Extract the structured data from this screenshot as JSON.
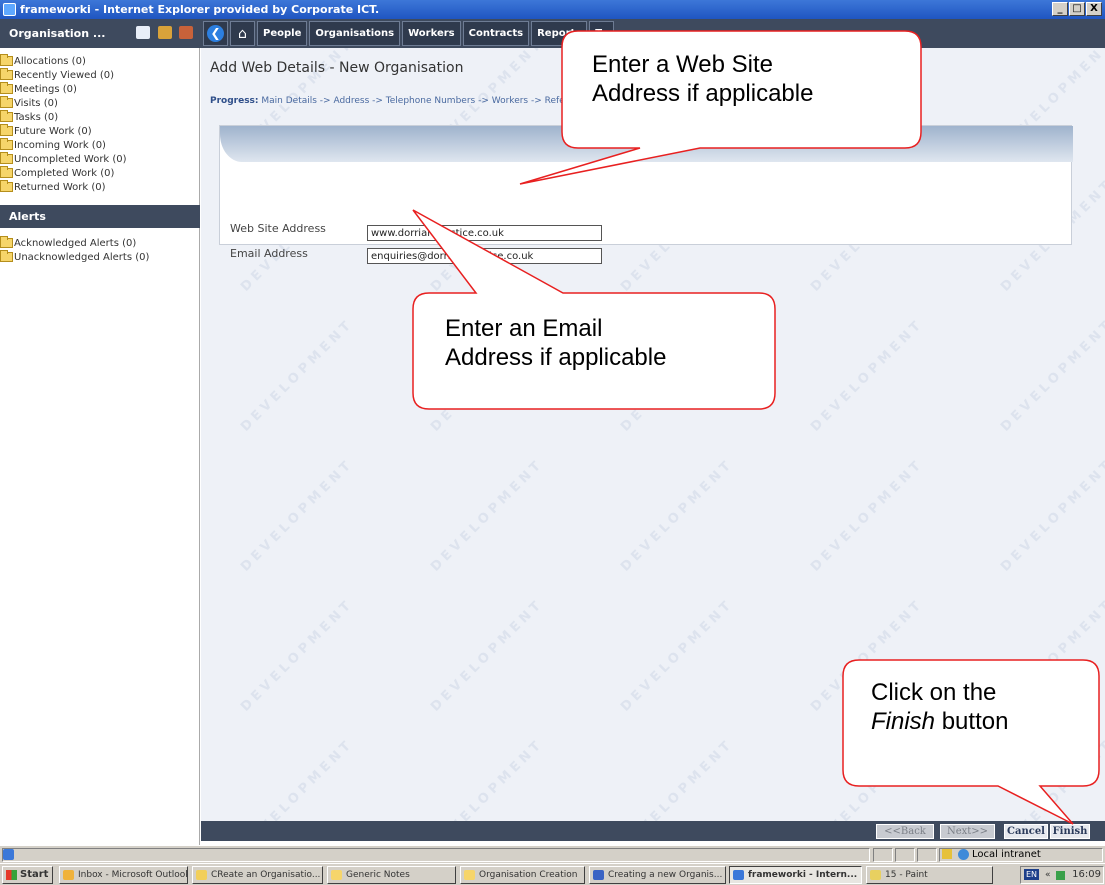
{
  "window": {
    "title": "frameworki - Internet Explorer provided by Corporate ICT.",
    "controls": [
      "_",
      "□",
      "X"
    ]
  },
  "toolbar": {
    "org_menu_label": "Organisation ...",
    "tabs": [
      "People",
      "Organisations",
      "Workers",
      "Contracts",
      "Reports",
      "To"
    ]
  },
  "sidebar": {
    "items": [
      "Allocations (0)",
      "Recently Viewed (0)",
      "Meetings (0)",
      "Visits (0)",
      "Tasks (0)",
      "Future Work (0)",
      "Incoming Work (0)",
      "Uncompleted Work (0)",
      "Completed Work (0)",
      "Returned Work (0)"
    ],
    "alerts_header": "Alerts",
    "alert_items": [
      "Acknowledged Alerts (0)",
      "Unacknowledged Alerts (0)"
    ]
  },
  "main": {
    "title": "Add Web Details - New Organisation",
    "progress_label": "Progress:",
    "progress_steps": "Main Details -> Address -> Telephone Numbers -> Workers -> Referenc",
    "watermark": "DEVELOPMENT",
    "form": {
      "web_label": "Web Site Address",
      "web_value": "www.dorrianpractice.co.uk",
      "email_label": "Email Address",
      "email_value": "enquiries@dorrianpractice.co.uk"
    }
  },
  "buttons": {
    "back": "<<Back",
    "next": "Next>>",
    "cancel": "Cancel",
    "finish": "Finish"
  },
  "statusbar": {
    "zone": "Local intranet"
  },
  "taskbar": {
    "start": "Start",
    "tasks": [
      "Inbox - Microsoft Outlook",
      "CReate an Organisatio...",
      "Generic Notes",
      "Organisation Creation",
      "Creating a new Organis...",
      "frameworki - Intern...",
      "15 - Paint"
    ],
    "lang": "EN",
    "clock": "16:09"
  },
  "callouts": {
    "web": [
      "Enter a Web Site",
      "Address if applicable"
    ],
    "email": [
      "Enter an Email",
      "Address if applicable"
    ],
    "finish_line1": "Click on the",
    "finish_italic": "Finish",
    "finish_after": " button"
  }
}
